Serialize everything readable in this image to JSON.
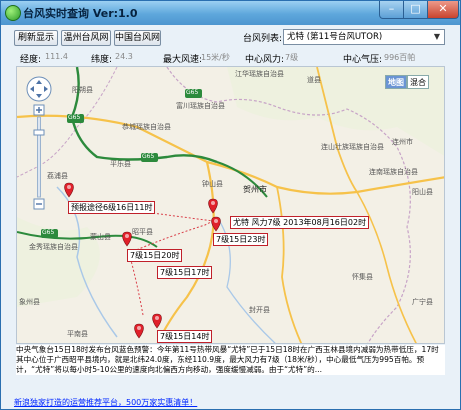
{
  "window": {
    "title": "台风实时查询 Ver:1.0",
    "buttons": {
      "minimize": "–",
      "maximize": "□",
      "close": "✕"
    }
  },
  "toolbar": {
    "refresh_label": "刷新显示",
    "wenzhou_label": "温州台风网",
    "china_label": "中国台风网",
    "list_label": "台风列表:",
    "selected_typhoon": "尤特 (第11号台风UTOR)"
  },
  "infobar": {
    "longitude_label": "经度:",
    "longitude_value": "111.4",
    "latitude_label": "纬度:",
    "latitude_value": "24.3",
    "max_wind_label": "最大风速:",
    "max_wind_value": "15米/秒",
    "center_force_label": "中心风力:",
    "center_force_value": "7级",
    "center_pressure_label": "中心气压:",
    "center_pressure_value": "996百帕"
  },
  "map": {
    "map_type_map": "地图",
    "map_type_hybrid": "混合",
    "cities": {
      "hezhou": "贺州市"
    },
    "places": [
      "江华瑶族自治县",
      "道县",
      "富川瑶族自治县",
      "恭城瑶族自治县",
      "钟山县",
      "平乐县",
      "荔浦县",
      "金秀瑶族自治县",
      "蒙山县",
      "昭平县",
      "怀集县",
      "连山壮族瑶族自治县",
      "连州市",
      "连南瑶族自治县",
      "阳山县",
      "广宁县",
      "象州县",
      "平南县",
      "封开县",
      "阳朔县"
    ],
    "road_labels": [
      "G65",
      "G65",
      "G65",
      "G65"
    ],
    "markers": [
      {
        "label": "预报途径6级16日11时"
      },
      {
        "label": "尤特  风力7级  2013年08月16日02时"
      },
      {
        "label": "7级15日23时"
      },
      {
        "label": "7级15日20时"
      },
      {
        "label": "7级15日17时"
      },
      {
        "label": "7级15日14时"
      }
    ]
  },
  "description": "中央气象台15日18时发布台风蓝色预警：今年第11号热带风暴“尤特”已于15日18时在广西玉林县境内减弱为热带低压，17时其中心位于广西昭平县境内，就是北纬24.0度，东经110.9度，最大风力有7级（18米/秒），中心最低气压为995百帕。预计，“尤特”将以每小时5-10公里的速度向北偏西方向移动，强度缓慢减弱。由于“尤特”的...",
  "ad_link": "新浪独家打造的运营推荐平台，500万家实惠清单！",
  "colors": {
    "title_bar": "#5ea7dc",
    "marker_red": "#e0202a",
    "highway_green": "#2c8a3c",
    "road_yellow": "#f6c24a"
  }
}
